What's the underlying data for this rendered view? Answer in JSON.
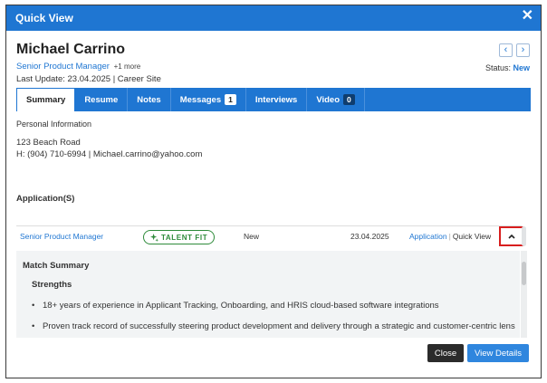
{
  "modal": {
    "title": "Quick View",
    "close_glyph": "✕"
  },
  "candidate": {
    "name": "Michael Carrino",
    "role": "Senior Product Manager",
    "more": "+1 more",
    "last_update": "Last Update: 23.04.2025 | Career Site",
    "status_label": "Status:",
    "status_value": "New"
  },
  "nav": {
    "prev_icon": "chevron-left-icon",
    "next_icon": "chevron-right-icon",
    "prev_glyph": "‹",
    "next_glyph": "›"
  },
  "tabs": [
    {
      "label": "Summary",
      "active": true
    },
    {
      "label": "Resume"
    },
    {
      "label": "Notes"
    },
    {
      "label": "Messages",
      "badge": "1"
    },
    {
      "label": "Interviews"
    },
    {
      "label": "Video",
      "badge": "0"
    }
  ],
  "personal": {
    "section_label": "Personal Information",
    "address": "123 Beach Road",
    "contact": "H: (904) 710-6994 | Michael.carrino@yahoo.com"
  },
  "applications": {
    "label": "Application(S)",
    "rows": [
      {
        "title": "Senior Product Manager",
        "badge": "TALENT FIT",
        "badge_icon": "sparkle-icon",
        "status": "New",
        "date": "23.04.2025",
        "link_application": "Application",
        "link_quick_view": "Quick View",
        "toggle_icon": "chevron-up-icon"
      }
    ]
  },
  "match": {
    "title": "Match Summary",
    "strengths_label": "Strengths",
    "bullets": [
      "18+ years of experience in Applicant Tracking, Onboarding, and HRIS cloud-based software integrations",
      "Proven track record of successfully steering product development and delivery through a strategic and customer-centric lens"
    ]
  },
  "footer": {
    "close": "Close",
    "view_details": "View Details"
  },
  "colors": {
    "primary": "#1f76d2",
    "talent_green": "#2e8b3a",
    "highlight_red": "#d81e1e",
    "dark_button": "#2b2b2b"
  }
}
